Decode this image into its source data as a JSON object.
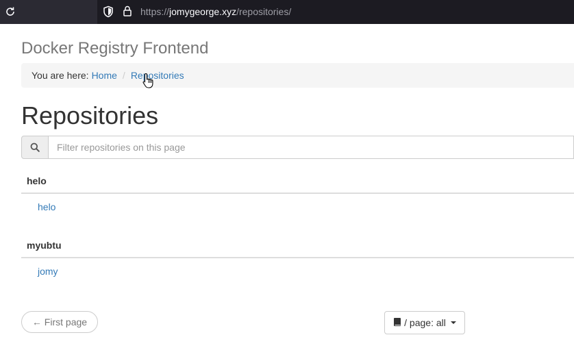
{
  "browser": {
    "url_scheme": "https://",
    "url_host": "jomygeorge.xyz",
    "url_path": "/repositories/"
  },
  "app": {
    "title": "Docker Registry Frontend"
  },
  "breadcrumb": {
    "prefix": "You are here:",
    "items": [
      {
        "label": "Home"
      },
      {
        "label": "Repositories"
      }
    ],
    "separator": "/"
  },
  "page": {
    "heading": "Repositories"
  },
  "filter": {
    "placeholder": "Filter repositories on this page"
  },
  "groups": [
    {
      "name": "helo",
      "repos": [
        "helo"
      ]
    },
    {
      "name": "myubtu",
      "repos": [
        "jomy"
      ]
    }
  ],
  "pagination": {
    "first_page_label": "← First page",
    "per_page_label": "/ page: all"
  },
  "colors": {
    "link": "#337ab7",
    "breadcrumb_bg": "#f5f5f5",
    "chrome_bg": "#1c1b22"
  }
}
